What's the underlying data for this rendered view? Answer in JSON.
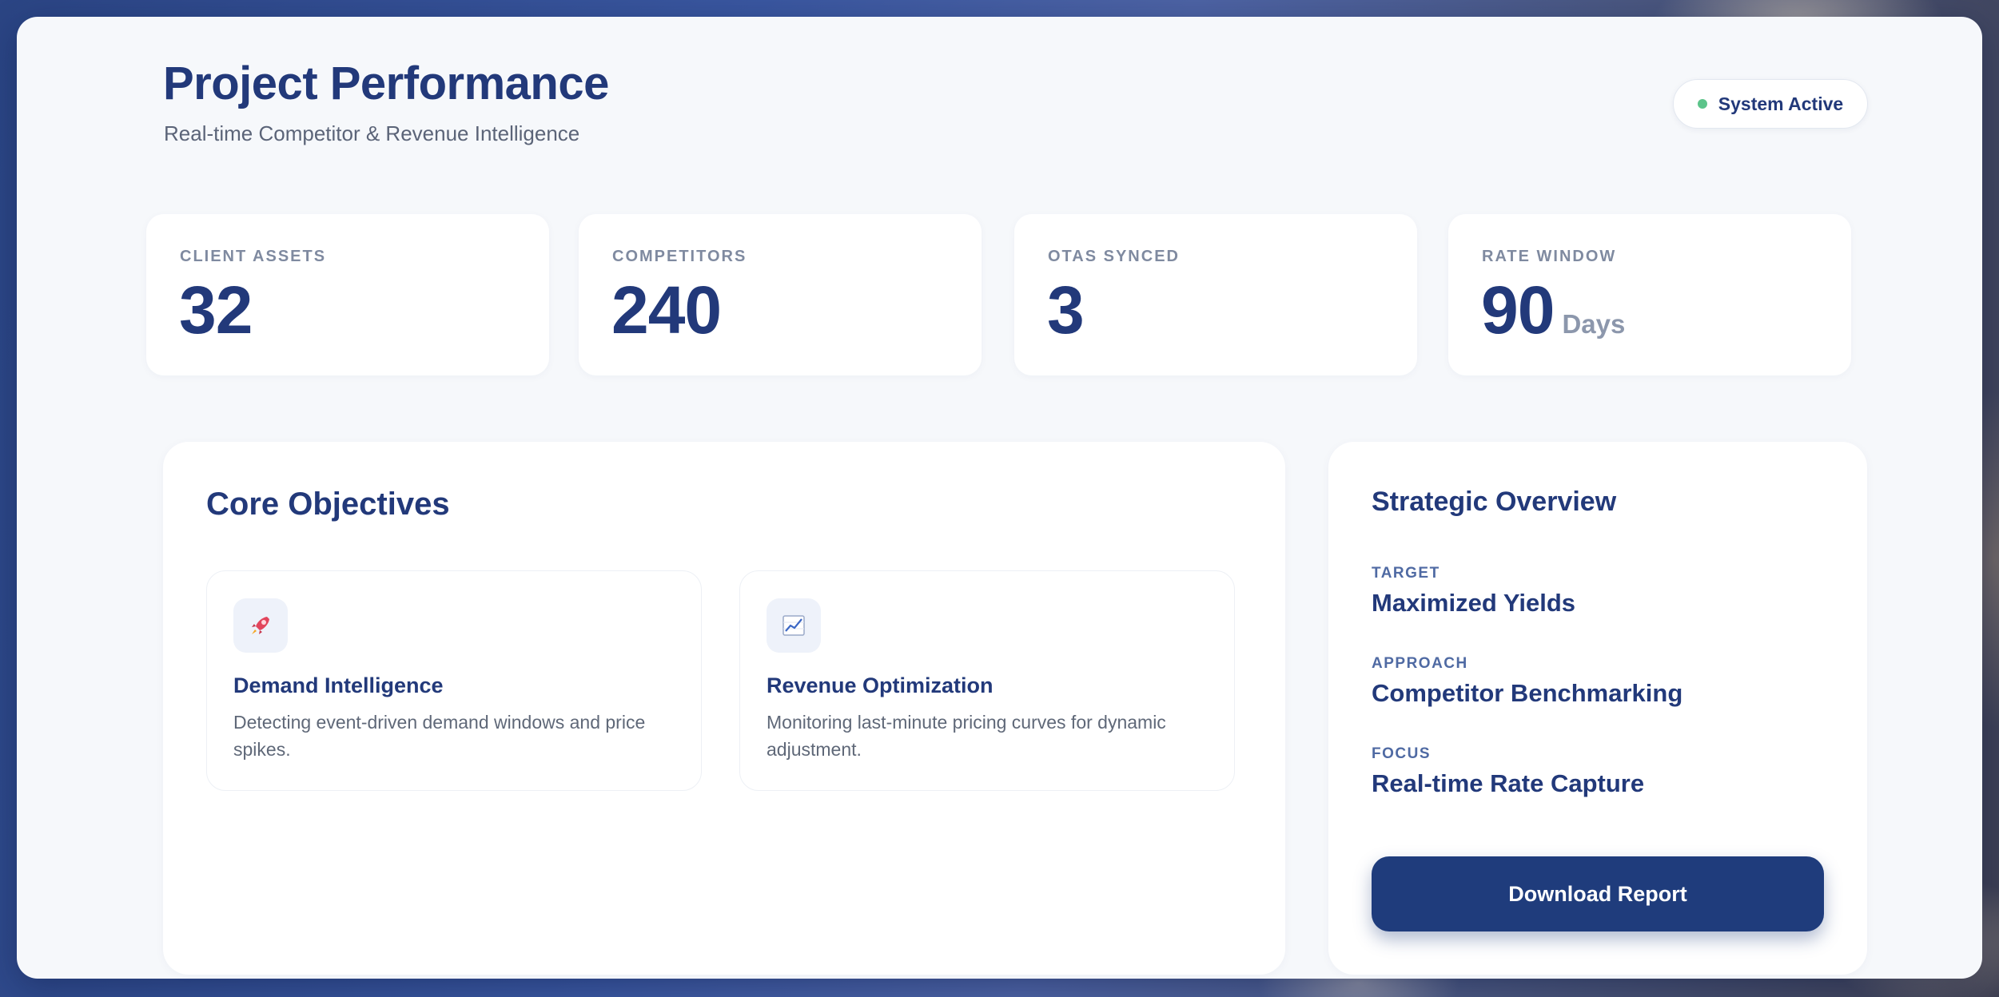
{
  "header": {
    "title": "Project Performance",
    "subtitle": "Real-time Competitor & Revenue Intelligence",
    "status": "System Active"
  },
  "stats": [
    {
      "label": "CLIENT ASSETS",
      "value": "32",
      "unit": ""
    },
    {
      "label": "COMPETITORS",
      "value": "240",
      "unit": ""
    },
    {
      "label": "OTAS SYNCED",
      "value": "3",
      "unit": ""
    },
    {
      "label": "RATE WINDOW",
      "value": "90",
      "unit": "Days"
    }
  ],
  "objectives": {
    "title": "Core Objectives",
    "items": [
      {
        "icon": "rocket-icon",
        "title": "Demand Intelligence",
        "description": "Detecting event-driven demand windows and price spikes."
      },
      {
        "icon": "chart-increasing-icon",
        "title": "Revenue Optimization",
        "description": "Monitoring last-minute pricing curves for dynamic adjustment."
      }
    ]
  },
  "overview": {
    "title": "Strategic Overview",
    "items": [
      {
        "label": "TARGET",
        "value": "Maximized Yields"
      },
      {
        "label": "APPROACH",
        "value": "Competitor Benchmarking"
      },
      {
        "label": "FOCUS",
        "value": "Real-time Rate Capture"
      }
    ],
    "button": "Download Report"
  },
  "colors": {
    "primary": "#22397a",
    "button": "#1f3c7c",
    "status": "#5cc48a",
    "panel": "#f6f8fb"
  }
}
